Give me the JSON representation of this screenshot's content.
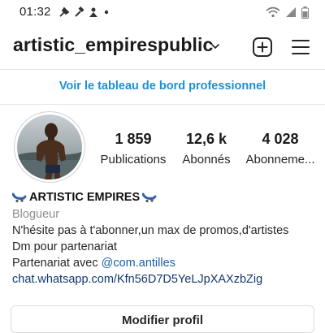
{
  "status_bar": {
    "time": "01:32",
    "icons": [
      "signal-tool-icon",
      "hammer-icon",
      "person-icon",
      "dot-icon"
    ],
    "right_icons": [
      "wifi-icon",
      "cell-signal-icon",
      "battery-icon"
    ]
  },
  "header": {
    "username": "artistic_empirespublic",
    "actions": [
      "dropdown-chevron-icon",
      "add-icon",
      "menu-icon"
    ]
  },
  "dashboard_link": "Voir le tableau de bord professionnel",
  "profile": {
    "stats": [
      {
        "value": "1 859",
        "label": "Publications"
      },
      {
        "value": "12,6 k",
        "label": "Abonnés"
      },
      {
        "value": "4 028",
        "label": "Abonneme..."
      }
    ],
    "display_name": "ARTISTIC EMPIRES",
    "category": "Blogueur",
    "bio_line1": "N'hésite pas à t'abonner,un max de promos,d'artistes",
    "bio_line2": "Dm pour partenariat",
    "bio_line3_prefix": "Partenariat avec ",
    "bio_mention": "@com.antilles",
    "link": "chat.whatsapp.com/Kfn56D7D5YeLJpXAXzbZig"
  },
  "edit_profile_button": "Modifier profil",
  "colors": {
    "link_blue": "#1c8fd6",
    "mention_blue": "#1a5fa8",
    "text": "#262626",
    "muted": "#8e8e8e"
  }
}
